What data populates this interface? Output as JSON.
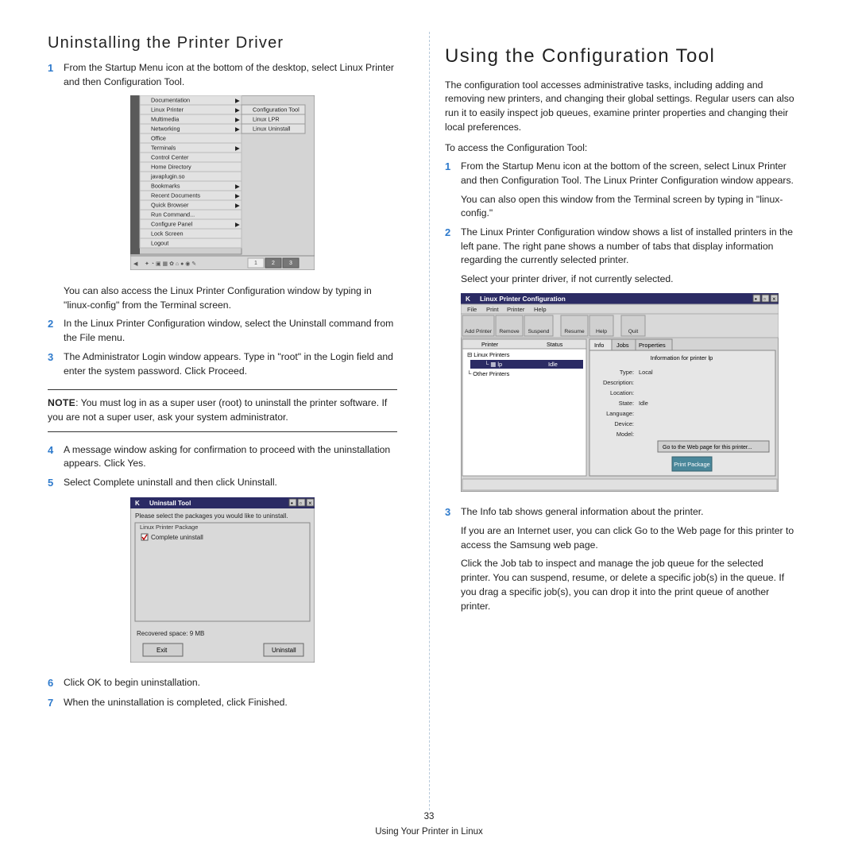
{
  "left": {
    "heading": "Uninstalling the Printer Driver",
    "steps": {
      "s1": "From the Startup Menu icon at the bottom of the desktop, select Linux Printer and then Configuration Tool.",
      "after1": "You can also access the Linux Printer Configuration window by typing in \"linux-config\" from the Terminal screen.",
      "s2": "In the Linux Printer Configuration window, select the Uninstall command from the File menu.",
      "s3": "The Administrator Login window appears. Type in \"root\" in the Login field and enter the system password. Click Proceed.",
      "note_label": "NOTE",
      "note_text": ": You must log in as a super user (root) to uninstall the printer software. If you are not a super user, ask your system administrator.",
      "s4": "A message window asking for confirmation to proceed with the uninstallation appears. Click Yes.",
      "s5": "Select Complete uninstall and then click Uninstall.",
      "s6": "Click OK to begin uninstallation.",
      "s7": "When the uninstallation is completed, click Finished."
    },
    "menu": {
      "items": [
        "Documentation",
        "Linux Printer",
        "Multimedia",
        "Networking",
        "Office",
        "Terminals",
        "Control Center",
        "Home Directory",
        "javaplugin.so",
        "Bookmarks",
        "Recent Documents",
        "Quick Browser",
        "Run Command...",
        "Configure Panel",
        "Lock Screen",
        "Logout"
      ],
      "sub": [
        "Configuration Tool",
        "Linux LPR",
        "Linux Uninstall"
      ]
    },
    "uninstall": {
      "title": "Uninstall Tool",
      "prompt": "Please select the packages you would like to uninstall.",
      "box_label": "Linux Printer Package",
      "checkbox": "Complete uninstall",
      "recovered": "Recovered space:  9 MB",
      "exit": "Exit",
      "uninstall_btn": "Uninstall"
    }
  },
  "right": {
    "heading": "Using the Configuration Tool",
    "intro": "The configuration tool accesses administrative tasks, including adding and removing new printers, and changing their global settings. Regular users can also run it to easily inspect job queues, examine printer properties and changing their local preferences.",
    "access": "To access the Configuration Tool:",
    "s1a": "From the Startup Menu icon at the bottom of the screen, select Linux Printer and then Configuration Tool. The Linux Printer Configuration window appears.",
    "s1b": "You can also open this window from the Terminal screen by typing in \"linux-config.\"",
    "s2a": "The Linux Printer Configuration window shows a list of installed printers in the left pane. The right pane shows a number of tabs that display information regarding the currently selected printer.",
    "s2b": "Select your printer driver, if not currently selected.",
    "cfg": {
      "title": "Linux Printer Configuration",
      "menus": [
        "File",
        "Print",
        "Printer",
        "Help"
      ],
      "toolbar": [
        "Add Printer",
        "Remove",
        "Suspend",
        "Resume",
        "Help",
        "Quit"
      ],
      "tree_hdr_l": "Printer",
      "tree_hdr_r": "Status",
      "tree_root": "Linux Printers",
      "tree_sel": "lp",
      "tree_sel_status": "Idle",
      "tree_other": "Other Printers",
      "tabs": [
        "Info",
        "Jobs",
        "Properties"
      ],
      "info_title": "Information for printer lp",
      "rows": [
        [
          "Type:",
          "Local"
        ],
        [
          "Description:",
          ""
        ],
        [
          "Location:",
          ""
        ],
        [
          "State:",
          "Idle"
        ],
        [
          "Language:",
          ""
        ],
        [
          "Device:",
          ""
        ],
        [
          "Model:",
          ""
        ]
      ],
      "web_btn": "Go to the Web page for this printer...",
      "brand": "Print Package"
    },
    "s3a": "The Info tab shows general information about the printer.",
    "s3b": "If you are an Internet user, you can click Go to the Web page for this printer to access the Samsung web page.",
    "s3c": "Click the Job tab to inspect and manage the job queue for the selected printer. You can suspend, resume, or delete a specific job(s) in the queue. If you drag a specific job(s), you can drop it into the print queue of another printer."
  },
  "footer": {
    "num": "33",
    "text": "Using Your Printer in Linux"
  }
}
